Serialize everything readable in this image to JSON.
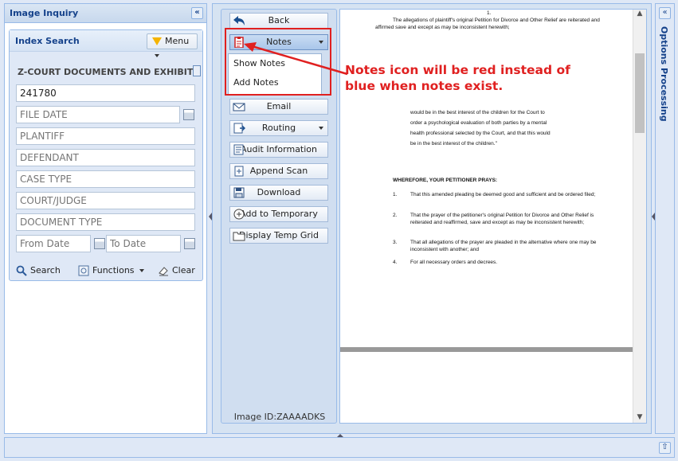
{
  "left_panel": {
    "title": "Image Inquiry",
    "collapse_glyph": "«",
    "index_search": {
      "title": "Index Search",
      "menu_label": "Menu",
      "section_title": "Z-COURT DOCUMENTS AND EXHIBITS",
      "fields": [
        {
          "name": "doc-id",
          "value": "241780",
          "placeholder": ""
        },
        {
          "name": "file-date",
          "value": "",
          "placeholder": "FILE DATE"
        },
        {
          "name": "plantiff",
          "value": "",
          "placeholder": "PLANTIFF"
        },
        {
          "name": "defendant",
          "value": "",
          "placeholder": "DEFENDANT"
        },
        {
          "name": "case-type",
          "value": "",
          "placeholder": "CASE TYPE"
        },
        {
          "name": "court-judge",
          "value": "",
          "placeholder": "COURT/JUDGE"
        },
        {
          "name": "document-type",
          "value": "",
          "placeholder": "DOCUMENT TYPE"
        }
      ],
      "from_date_placeholder": "From Date",
      "to_date_placeholder": "To Date",
      "search_label": "Search",
      "functions_label": "Functions",
      "clear_label": "Clear"
    }
  },
  "toolbar": {
    "back": "Back",
    "notes": "Notes",
    "notes_menu": [
      "Show Notes",
      "Add Notes"
    ],
    "email": "Email",
    "routing": "Routing",
    "audit": "Audit Information",
    "append_scan": "Append Scan",
    "download": "Download",
    "add_temp": "Add to Temporary",
    "display_temp": "Display Temp Grid",
    "image_id": "Image ID:ZAAAADKS"
  },
  "document": {
    "page_num": "1.",
    "para1": "The allegations of plaintiff's original Petition for Divorce and Other Relief are reiterated and affirmed save and except as may be inconsistent herewith;",
    "para2_lines": [
      "would be in the best interest of the children for the Court to",
      "order a psychological evaluation of both parties by a  mental",
      "health professional selected by the Court, and that this would",
      "be in the best interest of the children.\""
    ],
    "prayer_heading": "WHEREFORE, YOUR PETITIONER PRAYS:",
    "prayer_items": [
      {
        "num": "1.",
        "text": "That this amended pleading be deemed good and sufficient and be ordered filed;"
      },
      {
        "num": "2.",
        "text": "That the prayer of the petitioner's original Petition for Divorce and Other Relief is reiterated and reaffirmed, save and except as may be inconsistent herewith;"
      },
      {
        "num": "3.",
        "text": "That all allegations of the prayer are pleaded in the alternative where one may be inconsistent with another; and"
      },
      {
        "num": "4.",
        "text": "For all necessary orders and decrees."
      }
    ]
  },
  "right_panel": {
    "title": "Options Processing"
  },
  "annotation": {
    "line1": "Notes icon will be red instead of",
    "line2": "blue when notes exist.",
    "color": "#e02020"
  }
}
